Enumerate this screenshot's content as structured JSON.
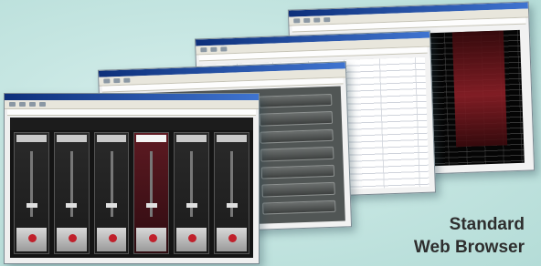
{
  "caption": {
    "line1": "Standard",
    "line2": "Web Browser"
  },
  "colors": {
    "background": "#c6e6e2",
    "window_frame": "#7b8a92",
    "title_bar": "#0d2f7a",
    "accent_red": "#c0202b",
    "caption_text": "#2e2e2e"
  },
  "icons": {
    "browser_windows": "stacked-browser-screenshots-icon"
  }
}
